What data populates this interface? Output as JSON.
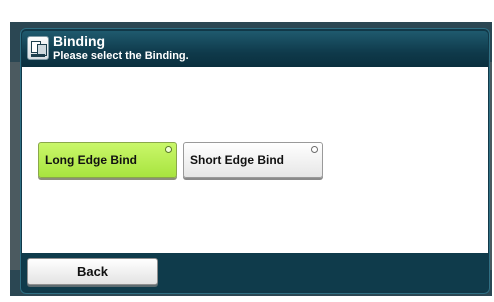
{
  "header": {
    "title": "Binding",
    "subtitle": "Please select the Binding.",
    "icon": "document-binding-icon"
  },
  "options": [
    {
      "label": "Long Edge Bind",
      "selected": true
    },
    {
      "label": "Short Edge Bind",
      "selected": false
    }
  ],
  "footer": {
    "back_label": "Back"
  },
  "colors": {
    "header_bg": "#0f3a4b",
    "selected_bg": "#b8ee52",
    "unselected_bg": "#f0f0f0"
  }
}
